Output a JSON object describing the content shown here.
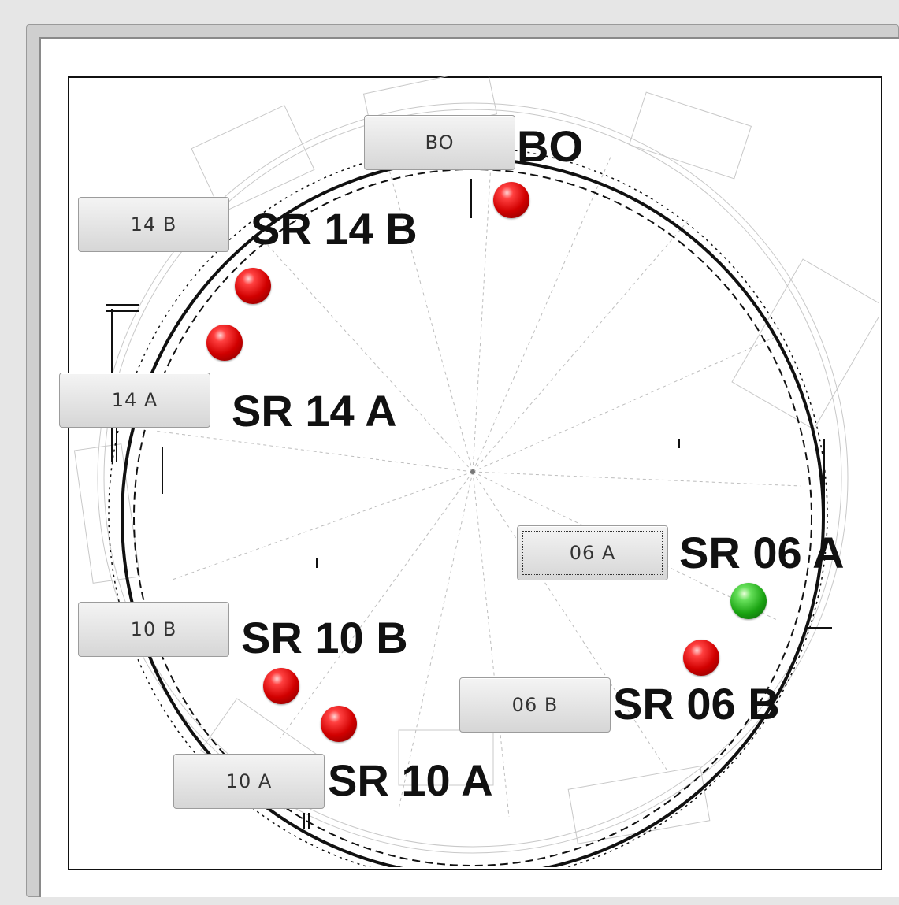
{
  "sections": {
    "bo": {
      "button": "BO",
      "label": "BO"
    },
    "s14b": {
      "button": "14 B",
      "label": "SR 14 B"
    },
    "s14a": {
      "button": "14 A",
      "label": "SR 14 A"
    },
    "s10b": {
      "button": "10 B",
      "label": "SR 10 B"
    },
    "s10a": {
      "button": "10 A",
      "label": "SR 10 A"
    },
    "s06a": {
      "button": "06 A",
      "label": "SR 06 A"
    },
    "s06b": {
      "button": "06 B",
      "label": "SR 06 B"
    }
  },
  "indicators": [
    {
      "name": "bo",
      "state": "fault"
    },
    {
      "name": "14b-1",
      "state": "fault"
    },
    {
      "name": "14b-2",
      "state": "fault"
    },
    {
      "name": "10b-1",
      "state": "fault"
    },
    {
      "name": "10b-2",
      "state": "fault"
    },
    {
      "name": "06a",
      "state": "ok"
    },
    {
      "name": "06b",
      "state": "fault"
    }
  ],
  "colors": {
    "fault": "#d10000",
    "ok": "#1aa312"
  }
}
